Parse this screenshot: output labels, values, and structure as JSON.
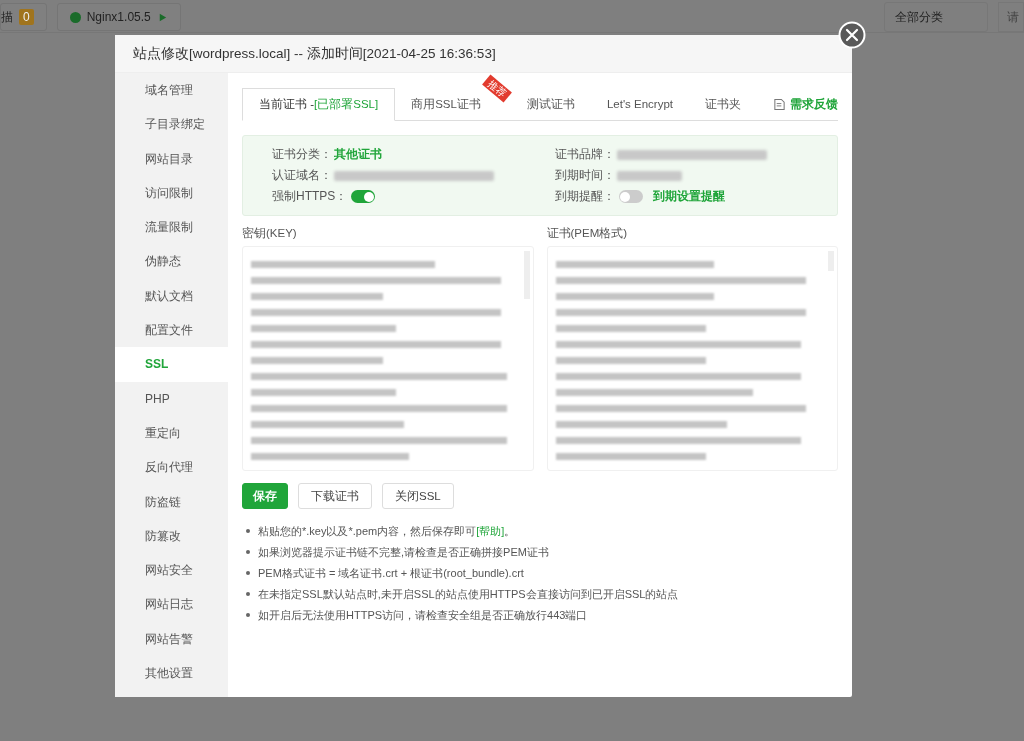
{
  "background": {
    "scan_label": "描",
    "scan_count": "0",
    "nginx_label": "Nginx1.05.5",
    "category_select": "全部分类",
    "cut_label": "请"
  },
  "dialog": {
    "title": "站点修改[wordpress.local] -- 添加时间[2021-04-25 16:36:53]",
    "sidebar": {
      "items": [
        {
          "label": "域名管理",
          "selected": false
        },
        {
          "label": "子目录绑定",
          "selected": false
        },
        {
          "label": "网站目录",
          "selected": false
        },
        {
          "label": "访问限制",
          "selected": false
        },
        {
          "label": "流量限制",
          "selected": false
        },
        {
          "label": "伪静态",
          "selected": false
        },
        {
          "label": "默认文档",
          "selected": false
        },
        {
          "label": "配置文件",
          "selected": false
        },
        {
          "label": "SSL",
          "selected": true
        },
        {
          "label": "PHP",
          "selected": false
        },
        {
          "label": "重定向",
          "selected": false
        },
        {
          "label": "反向代理",
          "selected": false
        },
        {
          "label": "防盗链",
          "selected": false
        },
        {
          "label": "防篡改",
          "selected": false
        },
        {
          "label": "网站安全",
          "selected": false
        },
        {
          "label": "网站日志",
          "selected": false
        },
        {
          "label": "网站告警",
          "selected": false
        },
        {
          "label": "其他设置",
          "selected": false
        }
      ]
    },
    "tabs": [
      {
        "label": "当前证书 -",
        "status": "[已部署SSL]",
        "selected": true
      },
      {
        "label": "商用SSL证书",
        "badge": "推荐",
        "selected": false
      },
      {
        "label": "测试证书",
        "selected": false
      },
      {
        "label": "Let's Encrypt",
        "selected": false
      },
      {
        "label": "证书夹",
        "selected": false
      }
    ],
    "feedback_link": "需求反馈",
    "info": {
      "category_label": "证书分类：",
      "category_value": "其他证书",
      "brand_label": "证书品牌：",
      "domain_label": "认证域名：",
      "expiry_label": "到期时间：",
      "force_https_label": "强制HTTPS：",
      "force_https_on": true,
      "reminder_label": "到期提醒：",
      "reminder_on": false,
      "reminder_link": "到期设置提醒"
    },
    "key_label": "密钥(KEY)",
    "cert_label": "证书(PEM格式)",
    "buttons": [
      {
        "label": "保存",
        "kind": "primary"
      },
      {
        "label": "下载证书",
        "kind": "default"
      },
      {
        "label": "关闭SSL",
        "kind": "default"
      }
    ],
    "notes": [
      {
        "text": "粘贴您的*.key以及*.pem内容，然后保存即可",
        "link": "[帮助]",
        "suffix": "。"
      },
      {
        "text": "如果浏览器提示证书链不完整,请检查是否正确拼接PEM证书"
      },
      {
        "text": "PEM格式证书 = 域名证书.crt + 根证书(root_bundle).crt"
      },
      {
        "text": "在未指定SSL默认站点时,未开启SSL的站点使用HTTPS会直接访问到已开启SSL的站点"
      },
      {
        "text": "如开启后无法使用HTTPS访问，请检查安全组是否正确放行443端口"
      }
    ]
  }
}
